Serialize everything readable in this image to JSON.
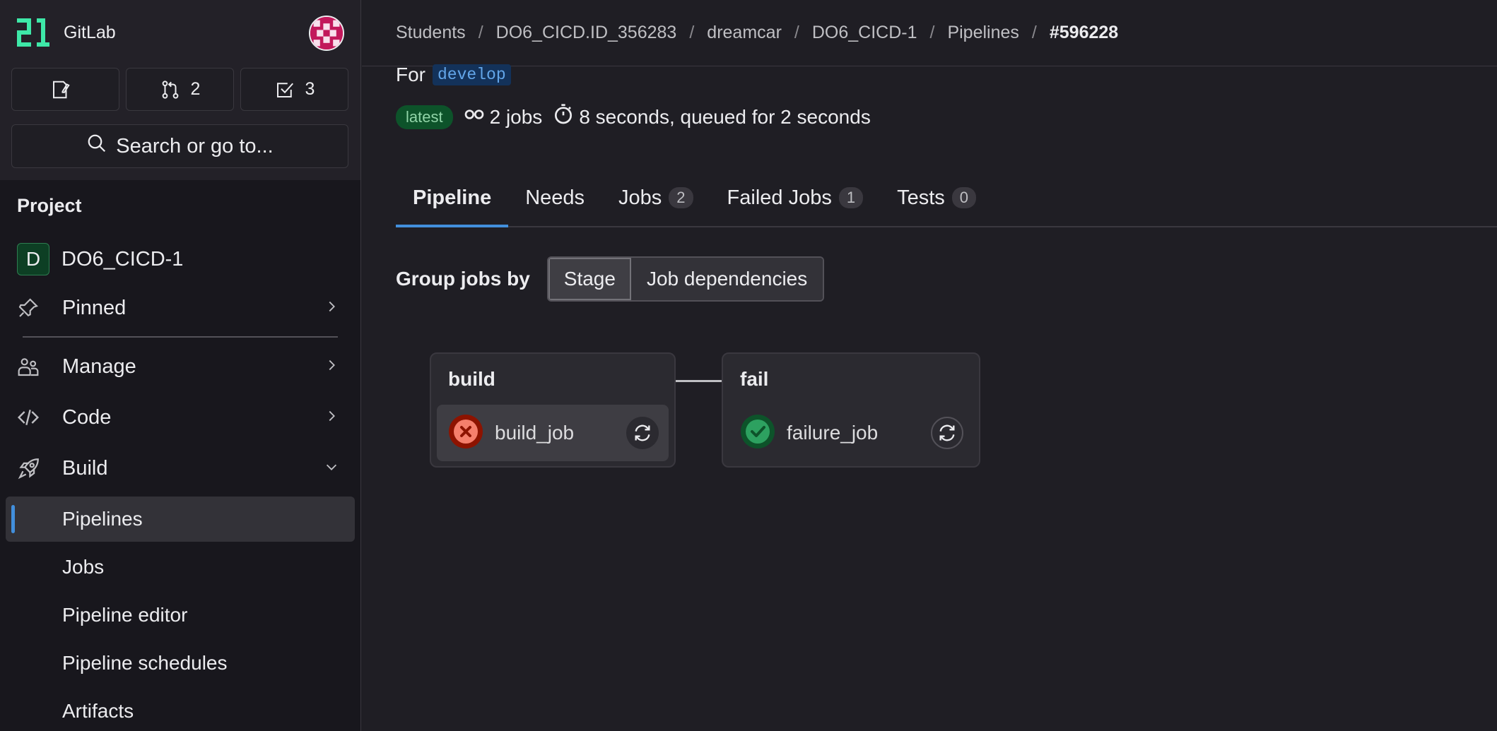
{
  "sidebar": {
    "brand": "GitLab",
    "counters": [
      {
        "icon": "issues-icon",
        "value": ""
      },
      {
        "icon": "merge-request-icon",
        "value": "2"
      },
      {
        "icon": "todo-icon",
        "value": "3"
      }
    ],
    "search_label": "Search or go to...",
    "section_title": "Project",
    "project": {
      "initial": "D",
      "name": "DO6_CICD-1"
    },
    "nav": [
      {
        "label": "Pinned",
        "icon": "pin-icon",
        "chevron": "right"
      },
      {
        "label": "Manage",
        "icon": "users-icon",
        "chevron": "right"
      },
      {
        "label": "Code",
        "icon": "code-icon",
        "chevron": "right"
      },
      {
        "label": "Build",
        "icon": "rocket-icon",
        "chevron": "down"
      }
    ],
    "sub_items": [
      "Pipelines",
      "Jobs",
      "Pipeline editor",
      "Pipeline schedules",
      "Artifacts"
    ],
    "active_sub_item": "Pipelines"
  },
  "breadcrumb": [
    "Students",
    "DO6_CICD.ID_356283",
    "dreamcar",
    "DO6_CICD-1",
    "Pipelines",
    "#596228"
  ],
  "pipeline": {
    "for_label": "For",
    "branch": "develop",
    "badge": "latest",
    "jobs_text": "2 jobs",
    "duration_text": "8 seconds, queued for 2 seconds"
  },
  "tabs": [
    {
      "label": "Pipeline",
      "count": null,
      "active": true
    },
    {
      "label": "Needs",
      "count": null,
      "active": false
    },
    {
      "label": "Jobs",
      "count": "2",
      "active": false
    },
    {
      "label": "Failed Jobs",
      "count": "1",
      "active": false
    },
    {
      "label": "Tests",
      "count": "0",
      "active": false
    }
  ],
  "group_by": {
    "label": "Group jobs by",
    "options": [
      "Stage",
      "Job dependencies"
    ],
    "selected": "Stage"
  },
  "stages": [
    {
      "name": "build",
      "job": "build_job",
      "status": "failed",
      "status_color": "#dd2b0e"
    },
    {
      "name": "fail",
      "job": "failure_job",
      "status": "success",
      "status_color": "#2da160"
    }
  ],
  "colors": {
    "accent": "#428fdc",
    "brand": "#3ee8a8",
    "background": "#1f1e24",
    "sidebar": "#18171d"
  }
}
